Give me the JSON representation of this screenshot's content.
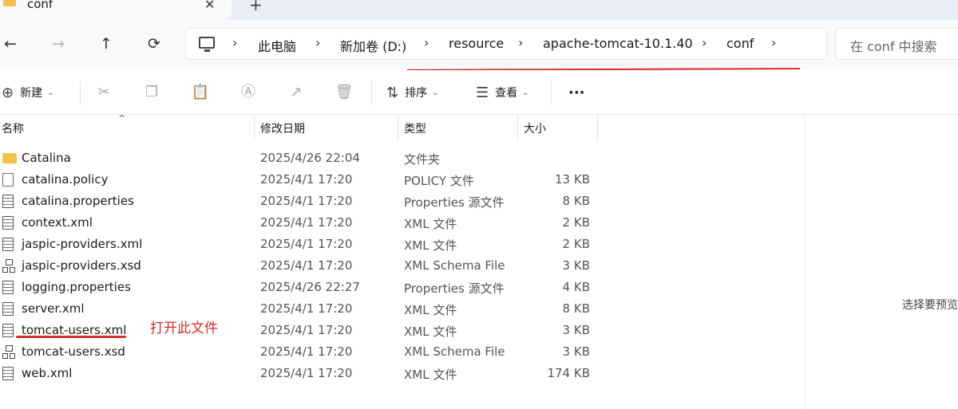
{
  "tab": {
    "title": "conf",
    "close": "✕",
    "new": "+"
  },
  "nav": {
    "back": "←",
    "forward": "→",
    "up": "↑",
    "refresh": "⟳"
  },
  "breadcrumb": {
    "separator": "›",
    "items": [
      "此电脑",
      "新加卷 (D:)",
      "resource",
      "apache-tomcat-10.1.40",
      "conf"
    ]
  },
  "search": {
    "placeholder": "在 conf 中搜索"
  },
  "toolbar": {
    "new_label": "新建",
    "sort_label": "排序",
    "view_label": "查看",
    "more_label": "···"
  },
  "columns": {
    "name": "名称",
    "date": "修改日期",
    "type": "类型",
    "size": "大小"
  },
  "files": [
    {
      "name": "Catalina",
      "date": "2025/4/26 22:04",
      "type": "文件夹",
      "size": "",
      "icon": "folder-icon"
    },
    {
      "name": "catalina.policy",
      "date": "2025/4/1 17:20",
      "type": "POLICY 文件",
      "size": "13 KB",
      "icon": "file-icon"
    },
    {
      "name": "catalina.properties",
      "date": "2025/4/1 17:20",
      "type": "Properties 源文件",
      "size": "8 KB",
      "icon": "text-file-icon"
    },
    {
      "name": "context.xml",
      "date": "2025/4/1 17:20",
      "type": "XML 文件",
      "size": "2 KB",
      "icon": "text-file-icon"
    },
    {
      "name": "jaspic-providers.xml",
      "date": "2025/4/1 17:20",
      "type": "XML 文件",
      "size": "2 KB",
      "icon": "text-file-icon"
    },
    {
      "name": "jaspic-providers.xsd",
      "date": "2025/4/1 17:20",
      "type": "XML Schema File",
      "size": "3 KB",
      "icon": "schema-file-icon"
    },
    {
      "name": "logging.properties",
      "date": "2025/4/26 22:27",
      "type": "Properties 源文件",
      "size": "4 KB",
      "icon": "text-file-icon"
    },
    {
      "name": "server.xml",
      "date": "2025/4/1 17:20",
      "type": "XML 文件",
      "size": "8 KB",
      "icon": "text-file-icon"
    },
    {
      "name": "tomcat-users.xml",
      "date": "2025/4/1 17:20",
      "type": "XML 文件",
      "size": "3 KB",
      "icon": "text-file-icon"
    },
    {
      "name": "tomcat-users.xsd",
      "date": "2025/4/1 17:20",
      "type": "XML Schema File",
      "size": "3 KB",
      "icon": "schema-file-icon"
    },
    {
      "name": "web.xml",
      "date": "2025/4/1 17:20",
      "type": "XML 文件",
      "size": "174 KB",
      "icon": "text-file-icon"
    }
  ],
  "annotation": {
    "text": "打开此文件",
    "color": "#d62b2b"
  },
  "preview": {
    "text": "选择要预览"
  }
}
